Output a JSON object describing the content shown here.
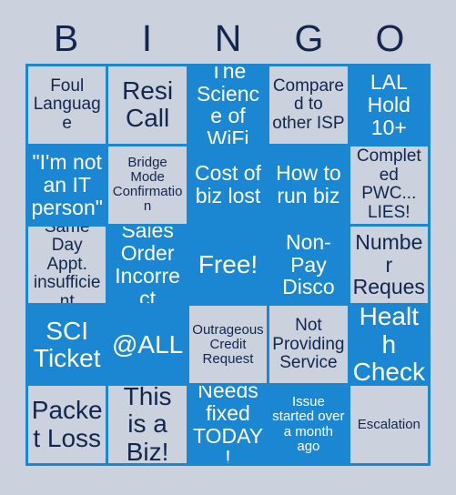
{
  "card": {
    "title": "BINGO",
    "header_letters": [
      "B",
      "I",
      "N",
      "G",
      "O"
    ],
    "colors": {
      "page_background": "#ccd2dd",
      "grid_line": "#1b87d2",
      "marked_cell": "#1b87d2",
      "unmarked_cell": "#ccd2dd",
      "marked_text": "#ffffff",
      "unmarked_text": "#12264f",
      "header_text": "#12264f"
    },
    "rows": 5,
    "columns": 5,
    "cells": [
      {
        "text": "Foul Language",
        "marked": false,
        "size": "md"
      },
      {
        "text": "Resi Call",
        "marked": false,
        "size": "xl"
      },
      {
        "text": "The Science of WiFi",
        "marked": true,
        "size": "lg"
      },
      {
        "text": "Compared to other ISP",
        "marked": false,
        "size": "md"
      },
      {
        "text": "LAL Hold 10+",
        "marked": true,
        "size": "lg"
      },
      {
        "text": "\"I'm not an IT person\"",
        "marked": true,
        "size": "lg"
      },
      {
        "text": "Bridge Mode Confirmation",
        "marked": false,
        "size": "sm"
      },
      {
        "text": "Cost of biz lost",
        "marked": true,
        "size": "lg"
      },
      {
        "text": "How to run biz",
        "marked": true,
        "size": "lg"
      },
      {
        "text": "Completed PWC... LIES!",
        "marked": false,
        "size": "md"
      },
      {
        "text": "Same Day Appt. insufficient",
        "marked": false,
        "size": "md"
      },
      {
        "text": "Sales Order Incorrect",
        "marked": true,
        "size": "lg"
      },
      {
        "text": "Free!",
        "marked": true,
        "size": "xl"
      },
      {
        "text": "Non-Pay Disco",
        "marked": true,
        "size": "lg"
      },
      {
        "text": "Ticket Number Request",
        "marked": false,
        "size": "lg"
      },
      {
        "text": "SCI Ticket",
        "marked": true,
        "size": "xl"
      },
      {
        "text": "@ALL",
        "marked": true,
        "size": "xl"
      },
      {
        "text": "Outrageous Credit Request",
        "marked": false,
        "size": "sm"
      },
      {
        "text": "Not Providing Service",
        "marked": false,
        "size": "md"
      },
      {
        "text": "Health Check",
        "marked": true,
        "size": "xl"
      },
      {
        "text": "Packet Loss",
        "marked": false,
        "size": "xl"
      },
      {
        "text": "This is a Biz!",
        "marked": false,
        "size": "xl"
      },
      {
        "text": "Needs fixed TODAY!",
        "marked": true,
        "size": "lg"
      },
      {
        "text": "Issue started over a month ago",
        "marked": true,
        "size": "sm"
      },
      {
        "text": "Escalation",
        "marked": false,
        "size": "sm"
      }
    ]
  }
}
